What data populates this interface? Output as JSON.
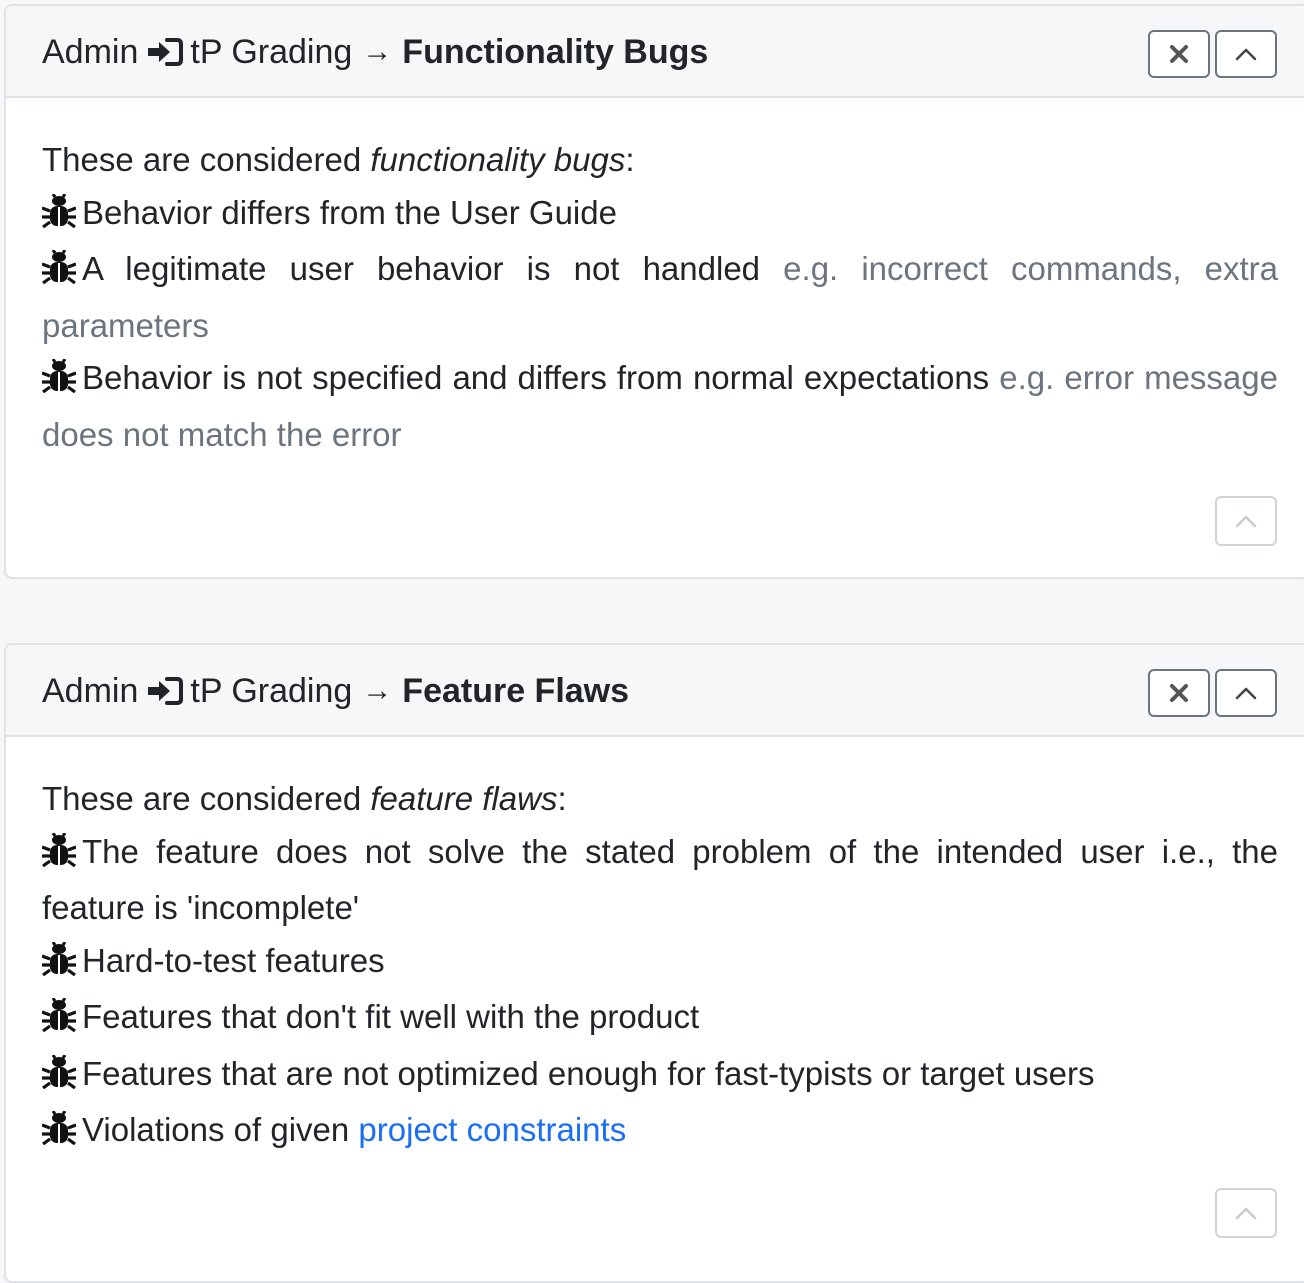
{
  "panels": [
    {
      "breadcrumb": {
        "root": "Admin",
        "section": "tP Grading",
        "title": "Functionality Bugs"
      },
      "intro": {
        "prefix": "These are considered ",
        "term": "functionality bugs",
        "suffix": ":"
      },
      "items": [
        {
          "text": "Behavior differs from the User Guide",
          "note": ""
        },
        {
          "text": "A legitimate user behavior is not handled",
          "note": "e.g. incorrect commands, extra parameters"
        },
        {
          "text": "Behavior is not specified and differs from normal expectations",
          "note": "e.g. error message does not match the error"
        }
      ]
    },
    {
      "breadcrumb": {
        "root": "Admin",
        "section": "tP Grading",
        "title": "Feature Flaws"
      },
      "intro": {
        "prefix": "These are considered ",
        "term": "feature flaws",
        "suffix": ":"
      },
      "items": [
        {
          "text": "The feature does not solve the stated problem of the intended user i.e., the feature is 'incomplete'"
        },
        {
          "text": "Hard-to-test features"
        },
        {
          "text": "Features that don't fit well with the product"
        },
        {
          "text": "Features that are not optimized enough for fast-typists or target users"
        },
        {
          "text": "Violations of given ",
          "link": "project constraints"
        }
      ]
    }
  ],
  "icons": {
    "breadcrumb_separator": "login-icon",
    "item_bullet": "bug-icon",
    "close": "close-icon",
    "collapse": "chevron-up-icon"
  },
  "colors": {
    "muted": "#6c757d",
    "link": "#1a6ef5",
    "header_bg": "#f6f7f8",
    "page_bg": "#f6f7f9"
  }
}
